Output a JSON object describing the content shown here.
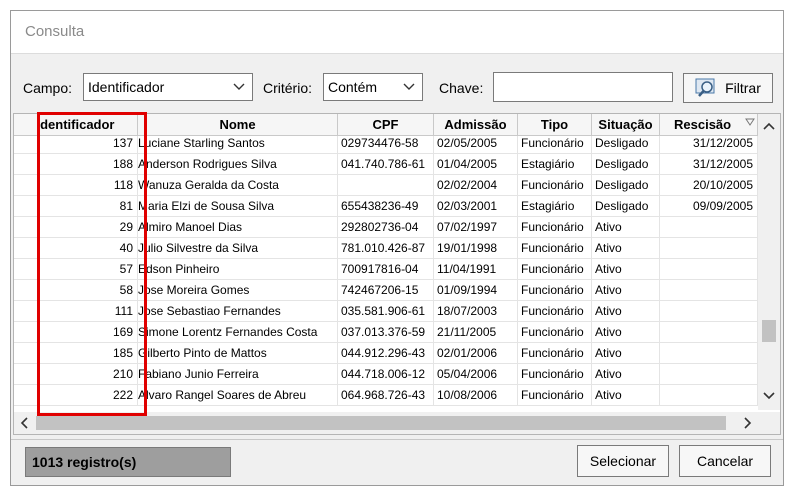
{
  "window": {
    "title": "Consulta"
  },
  "filter": {
    "campo_label": "Campo:",
    "campo_value": "Identificador",
    "criterio_label": "Critério:",
    "criterio_value": "Contém",
    "chave_label": "Chave:",
    "chave_value": "",
    "filtrar_label": "Filtrar"
  },
  "table": {
    "columns": [
      "Identificador",
      "Nome",
      "CPF",
      "Admissão",
      "Tipo",
      "Situação",
      "Rescisão"
    ],
    "rows": [
      [
        "137",
        "Luciane Starling Santos",
        "029734476-58",
        "02/05/2005",
        "Funcionário",
        "Desligado",
        "31/12/2005"
      ],
      [
        "188",
        "Anderson Rodrigues Silva",
        "041.740.786-61",
        "01/04/2005",
        "Estagiário",
        "Desligado",
        "31/12/2005"
      ],
      [
        "118",
        "Wanuza Geralda da Costa",
        "",
        "02/02/2004",
        "Funcionário",
        "Desligado",
        "20/10/2005"
      ],
      [
        "81",
        "Maria Elzi de Sousa Silva",
        "655438236-49",
        "02/03/2001",
        "Estagiário",
        "Desligado",
        "09/09/2005"
      ],
      [
        "29",
        "Almiro Manoel Dias",
        "292802736-04",
        "07/02/1997",
        "Funcionário",
        "Ativo",
        ""
      ],
      [
        "40",
        "Julio Silvestre da Silva",
        "781.010.426-87",
        "19/01/1998",
        "Funcionário",
        "Ativo",
        ""
      ],
      [
        "57",
        "Edson Pinheiro",
        "700917816-04",
        "11/04/1991",
        "Funcionário",
        "Ativo",
        ""
      ],
      [
        "58",
        "Jose Moreira Gomes",
        "742467206-15",
        "01/09/1994",
        "Funcionário",
        "Ativo",
        ""
      ],
      [
        "111",
        "Jose Sebastiao Fernandes",
        "035.581.906-61",
        "18/07/2003",
        "Funcionário",
        "Ativo",
        ""
      ],
      [
        "169",
        "Simone Lorentz Fernandes Costa",
        "037.013.376-59",
        "21/11/2005",
        "Funcionário",
        "Ativo",
        ""
      ],
      [
        "185",
        "Gilberto Pinto de Mattos",
        "044.912.296-43",
        "02/01/2006",
        "Funcionário",
        "Ativo",
        ""
      ],
      [
        "210",
        "Fabiano Junio Ferreira",
        "044.718.006-12",
        "05/04/2006",
        "Funcionário",
        "Ativo",
        ""
      ],
      [
        "222",
        "Alvaro Rangel Soares de Abreu",
        "064.968.726-43",
        "10/08/2006",
        "Funcionário",
        "Ativo",
        ""
      ]
    ]
  },
  "footer": {
    "status": "1013 registro(s)",
    "select_label": "Selecionar",
    "cancel_label": "Cancelar"
  },
  "colors": {
    "highlight": "#e00000",
    "status_bg": "#9e9e9e"
  },
  "icons": {
    "filter_button": "search-magnifier-icon",
    "sort": "sort-indicator-icon"
  }
}
